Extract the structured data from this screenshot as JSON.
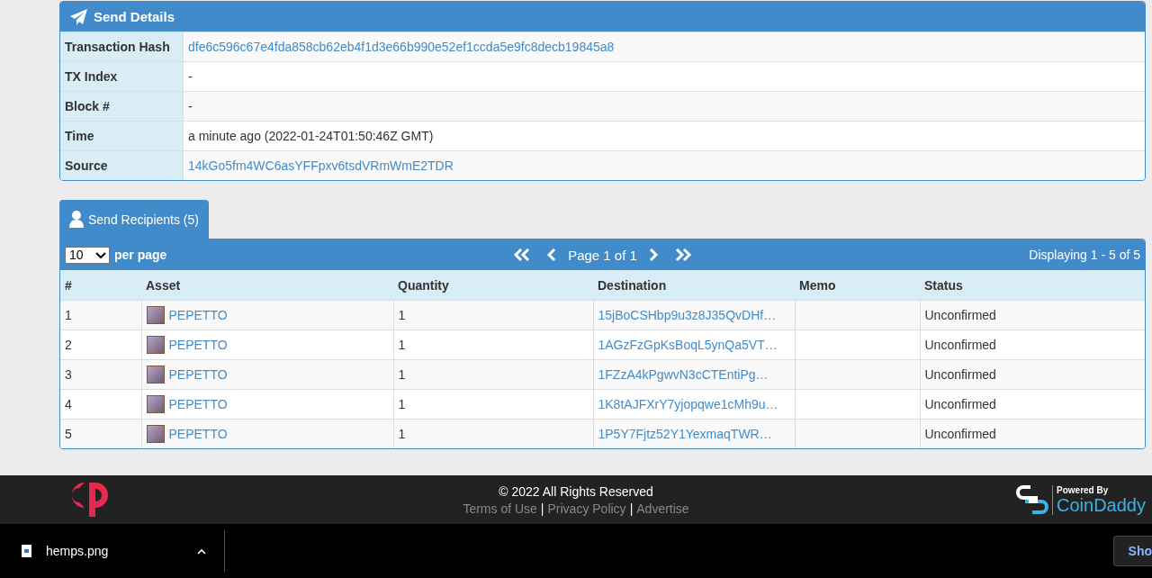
{
  "send_details": {
    "title": "Send Details",
    "fields": [
      {
        "label": "Transaction Hash",
        "value": "dfe6c596c67e4fda858cb62eb4f1d3e66b990e52ef1ccda5e9fc8decb19845a8",
        "kind": "link"
      },
      {
        "label": "TX Index",
        "value": "-",
        "kind": "text"
      },
      {
        "label": "Block #",
        "value": "-",
        "kind": "text"
      },
      {
        "label": "Time",
        "value": "a minute ago (2022-01-24T01:50:46Z GMT)",
        "kind": "text"
      },
      {
        "label": "Source",
        "value": "14kGo5fm4WC6asYFFpxv6tsdVRmWmE2TDR",
        "kind": "link"
      }
    ]
  },
  "recipients": {
    "tab": {
      "label": "Send Recipients (5)",
      "selected": true
    },
    "per_page": {
      "value": "10",
      "label": "per page"
    },
    "page_text": "Page 1 of 1",
    "displaying": "Displaying 1 - 5 of 5",
    "columns": [
      "#",
      "Asset",
      "Quantity",
      "Destination",
      "Memo",
      "Status"
    ],
    "rows": [
      {
        "index": "1",
        "asset": "PEPETTO",
        "quantity": "1",
        "destination": "15jBoCSHbp9u3z8J35QvDHf…",
        "status": "Unconfirmed"
      },
      {
        "index": "2",
        "asset": "PEPETTO",
        "quantity": "1",
        "destination": "1AGzFzGpKsBoqL5ynQa5VT…",
        "status": "Unconfirmed"
      },
      {
        "index": "3",
        "asset": "PEPETTO",
        "quantity": "1",
        "destination": "1FZzA4kPgwvN3cCTEntiPg…",
        "status": "Unconfirmed"
      },
      {
        "index": "4",
        "asset": "PEPETTO",
        "quantity": "1",
        "destination": "1K8tAJFXrY7yjopqwe1cMh9u…",
        "status": "Unconfirmed"
      },
      {
        "index": "5",
        "asset": "PEPETTO",
        "quantity": "1",
        "destination": "1P5Y7Fjtz52Y1YexmaqTWR…",
        "status": "Unconfirmed"
      }
    ]
  },
  "footer": {
    "copyright": "© 2022 All Rights Reserved",
    "links": [
      "Terms of Use",
      "Privacy Policy",
      "Advertise"
    ],
    "separator": "|",
    "powered_by": "Powered By",
    "brand": "CoinDaddy"
  },
  "download_bar": {
    "file_name": "hemps.png",
    "button": "Sho"
  }
}
